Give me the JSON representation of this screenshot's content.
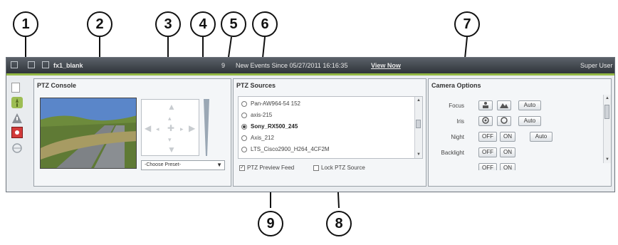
{
  "titlebar": {
    "window_title": "fx1_blank",
    "events_prefix": "9",
    "events_text": "New Events Since 05/27/2011 16:16:35",
    "view_now": "View Now",
    "user": "Super User"
  },
  "left_strip": {
    "icons": [
      "ptz-icon",
      "warning-icon",
      "camera-icon",
      "globe-icon"
    ]
  },
  "ptz_console": {
    "title": "PTZ Console",
    "preset_placeholder": "-Choose Preset-"
  },
  "ptz_sources": {
    "title": "PTZ Sources",
    "items": [
      {
        "label": "Pan-AW964-54 152",
        "selected": false
      },
      {
        "label": "axis-215",
        "selected": false
      },
      {
        "label": "Sony_RX500_245",
        "selected": true
      },
      {
        "label": "Axis_212",
        "selected": false
      },
      {
        "label": "LTS_Cisco2900_H264_4CF2M",
        "selected": false
      }
    ],
    "preview_feed_label": "PTZ Preview Feed",
    "preview_feed_checked": true,
    "lock_source_label": "Lock PTZ Source",
    "lock_source_checked": false
  },
  "camera_options": {
    "title": "Camera Options",
    "rows": [
      {
        "label": "Focus",
        "buttons": [
          "",
          "",
          "Auto"
        ]
      },
      {
        "label": "Iris",
        "buttons": [
          "",
          "",
          "Auto"
        ]
      },
      {
        "label": "Night",
        "buttons": [
          "OFF",
          "ON",
          "Auto"
        ]
      },
      {
        "label": "Backlight",
        "buttons": [
          "OFF",
          "ON"
        ]
      },
      {
        "label": "",
        "buttons": [
          "OFF",
          "ON"
        ]
      }
    ]
  },
  "callouts": [
    "1",
    "2",
    "3",
    "4",
    "5",
    "6",
    "7",
    "8",
    "9"
  ],
  "colors": {
    "accent_green": "#93b844",
    "titlebar_dark": "#2f343a"
  }
}
